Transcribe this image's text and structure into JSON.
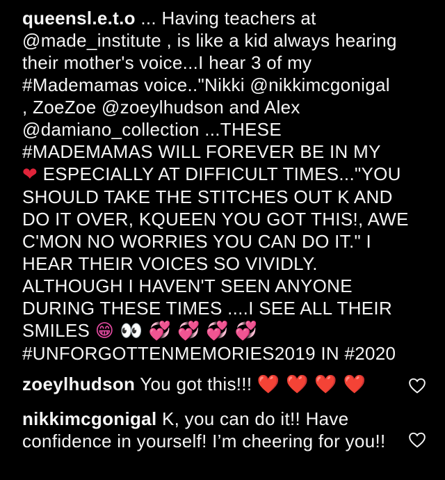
{
  "post": {
    "username": "queensl.e.t.o",
    "caption_lines": [
      " ... Having teachers at",
      "@made_institute , is like a kid always hearing",
      "their mother's voice...I hear 3 of my",
      "#Mademamas voice..\"Nikki @nikkimcgonigal",
      ", ZoeZoe @zoeylhudson  and Alex",
      "@damiano_collection ...THESE",
      "#MADEMAMAS  WILL  FOREVER  BE IN MY"
    ],
    "heart_emoji": "❤",
    "caption_lines_2": [
      " ESPECIALLY AT DIFFICULT TIMES...\"YOU",
      "SHOULD TAKE THE STITCHES OUT K AND",
      "DO IT OVER, KQUEEN YOU GOT THIS!, AWE",
      "C'MON NO WORRIES YOU CAN DO IT.\" I",
      "HEAR THEIR VOICES SO VIVIDLY.",
      "ALTHOUGH I HAVEN'T SEEN ANYONE",
      "DURING THESE TIMES ....I SEE ALL THEIR"
    ],
    "smiles_text": "SMILES ",
    "smiles_emojis": "😁 👀 💞 💞 💞 💞",
    "last_line": "#UNFORGOTTENMEMORIES2019 IN #2020"
  },
  "comments": [
    {
      "username": "zoeylhudson",
      "text": " You got this!!! ",
      "emojis": "❤️ ❤️ ❤️ ❤️"
    },
    {
      "username": "nikkimcgonigal",
      "text": " K, you can do it!! Have confidence in yourself! I’m cheering for you!!"
    }
  ],
  "icons": {
    "like": "heart-outline-icon"
  },
  "colors": {
    "background": "#000000",
    "text": "#f5f5f5",
    "heart_red": "#e0243a",
    "heart_pink": "#e24aa0"
  }
}
